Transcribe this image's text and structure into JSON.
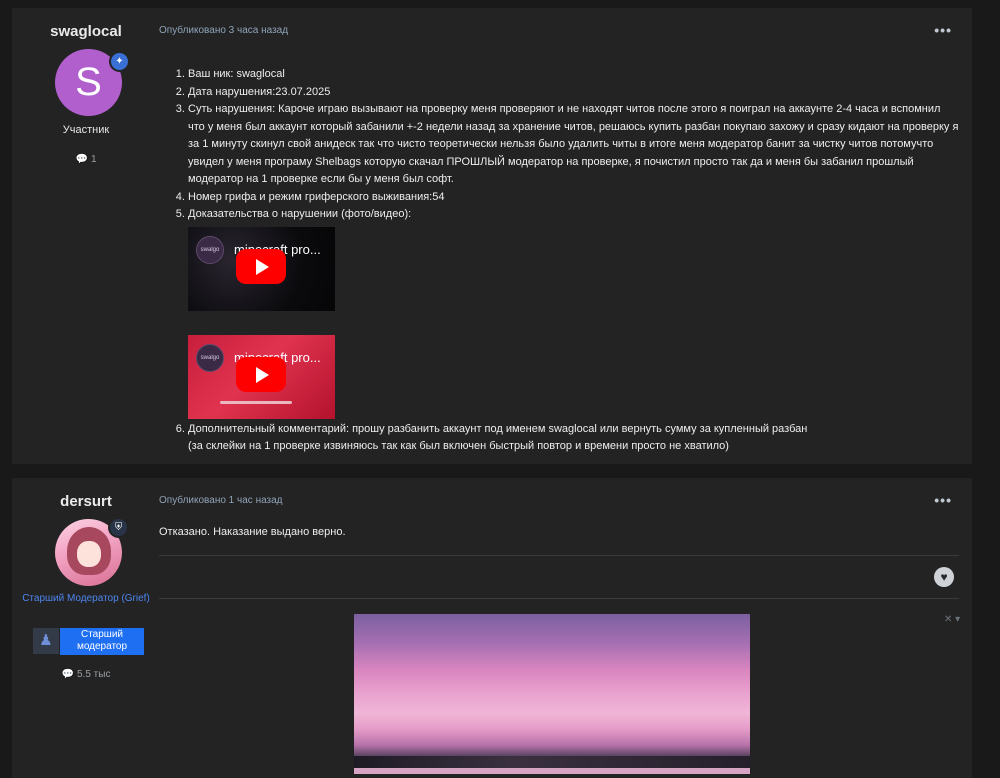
{
  "posts": [
    {
      "author": "swaglocal",
      "avatar_letter": "S",
      "role": "Участник",
      "post_count": "1",
      "published": "Опубликовано 3 часа назад",
      "items": [
        "Ваш ник: swaglocal",
        "Дата нарушения:23.07.2025",
        "Суть нарушения: Кароче играю вызывают на проверку меня проверяют и не находят читов после этого я поиграл на аккаунте 2-4 часа и вспомнил что у меня был аккаунт который забанили +-2 недели назад за хранение читов, решаюсь купить разбан покупаю захожу и сразу кидают на проверку я за 1 минуту скинул свой анидеск так что чисто теоретически нельзя было удалить читы в итоге меня модератор банит за чистку читов потомучто увидел у меня програму Shelbags которую скачал ПРОШЛЫЙ модератор на проверке, я почистил просто так да и меня бы забанил прошлый модератор на 1 проверке если бы у меня был софт.",
        "Номер грифа и режим гриферского выживания:54",
        "Доказательства о нарушении (фото/видео):",
        "Дополнительный комментарий: прошу разбанить аккаунт под именем swaglocal или вернуть сумму за купленный разбан",
        "(за склейки на 1 проверке извиняюсь так как был включен быстрый повтор и времени просто не хватило)"
      ],
      "videos": [
        {
          "title": "minecraft pro...",
          "channel": "swalgo"
        },
        {
          "title": "minecraft pro...",
          "channel": "swalgo"
        }
      ]
    },
    {
      "author": "dersurt",
      "role": "Старший Модератор (Grief)",
      "badge": "Старший модератор",
      "post_count": "5.5 тыс",
      "published": "Опубликовано 1 час назад",
      "text": "Отказано. Наказание выдано верно."
    }
  ],
  "icons": {
    "more": "•••",
    "comment": "comment-icon",
    "heart": "heart-icon",
    "shield": "shield-icon"
  },
  "colors": {
    "background": "#191919",
    "post_bg": "#232323",
    "accent_blue": "#1f6ff2",
    "avatar_purple": "#b25fce"
  }
}
